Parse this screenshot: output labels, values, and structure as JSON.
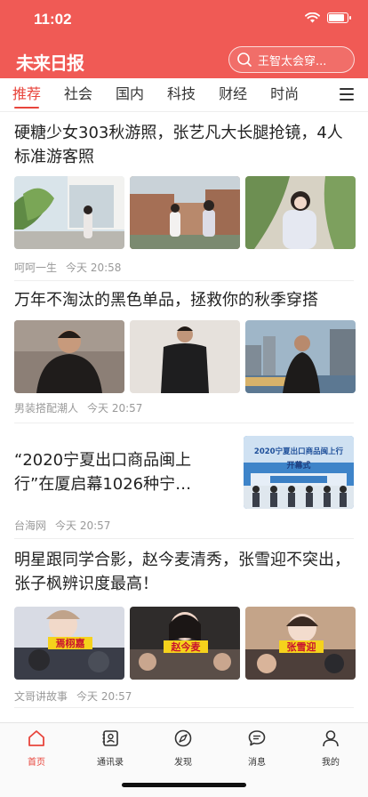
{
  "status_bar": {
    "time": "11:02"
  },
  "header": {
    "logo": "未来日报",
    "search_placeholder": "王智太会穿..."
  },
  "tabs": [
    {
      "label": "推荐",
      "active": true
    },
    {
      "label": "社会"
    },
    {
      "label": "国内"
    },
    {
      "label": "科技"
    },
    {
      "label": "财经"
    },
    {
      "label": "时尚"
    }
  ],
  "articles": [
    {
      "title": "硬糖少女303秋游照，张艺凡大长腿抢镜，4人标准游客照",
      "source": "呵呵一生",
      "time": "今天 20:58"
    },
    {
      "title": "万年不淘汰的黑色单品，拯救你的秋季穿搭",
      "source": "男装搭配潮人",
      "time": "今天 20:57"
    },
    {
      "title": "“2020宁夏出口商品闽上行”在厦启幕1026种宁…",
      "source": "台海网",
      "time": "今天 20:57",
      "image_banner": "2020宁夏出口商品闽上行",
      "image_stage": "开幕式"
    },
    {
      "title": "明星跟同学合影，赵今麦清秀，张雪迎不突出，张子枫辨识度最高！",
      "source": "文哥讲故事",
      "time": "今天 20:57",
      "image_captions": [
        "焉栩嘉",
        "赵今麦",
        "张雪迎"
      ]
    }
  ],
  "tabbar": [
    {
      "label": "首页",
      "icon": "home-icon",
      "active": true
    },
    {
      "label": "通讯录",
      "icon": "contacts-icon"
    },
    {
      "label": "发现",
      "icon": "discover-icon"
    },
    {
      "label": "消息",
      "icon": "message-icon"
    },
    {
      "label": "我的",
      "icon": "profile-icon"
    }
  ],
  "battery_level": 0.9,
  "colors": {
    "brand": "#f05a55",
    "active": "#e8453c",
    "meta": "#999999"
  }
}
